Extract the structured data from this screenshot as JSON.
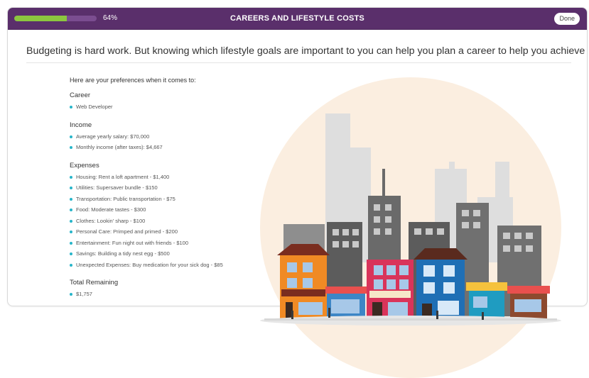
{
  "header": {
    "progress_percent": 64,
    "progress_label": "64%",
    "title": "CAREERS AND LIFESTYLE COSTS",
    "done_label": "Done"
  },
  "intro": "Budgeting is hard work. But knowing which lifestyle goals are important to you can help you plan a career to help you achieve them.",
  "preferences": {
    "lead": "Here are your preferences when it comes to:",
    "career": {
      "heading": "Career",
      "items": [
        "Web Developer"
      ]
    },
    "income": {
      "heading": "Income",
      "items": [
        "Average yearly salary: $70,000",
        "Monthly income (after taxes): $4,667"
      ]
    },
    "expenses": {
      "heading": "Expenses",
      "items": [
        "Housing: Rent a loft apartment - $1,400",
        "Utilities: Supersaver bundle - $150",
        "Transportation: Public transportation - $75",
        "Food: Moderate tastes - $300",
        "Clothes: Lookin' sharp - $100",
        "Personal Care: Primped and primed - $200",
        "Entertainment: Fun night out with friends - $100",
        "Savings: Building a tidy nest egg - $500",
        "Unexpected Expenses: Buy medication for your sick dog - $85"
      ]
    },
    "total": {
      "heading": "Total Remaining",
      "items": [
        "$1,757"
      ]
    }
  },
  "colors": {
    "header_bg": "#5a2f6b",
    "progress_fill": "#8cc63f",
    "bullet": "#27b5c9",
    "scene_circle": "#fbeee0"
  },
  "illustration": {
    "icon": "city-street-illustration"
  }
}
